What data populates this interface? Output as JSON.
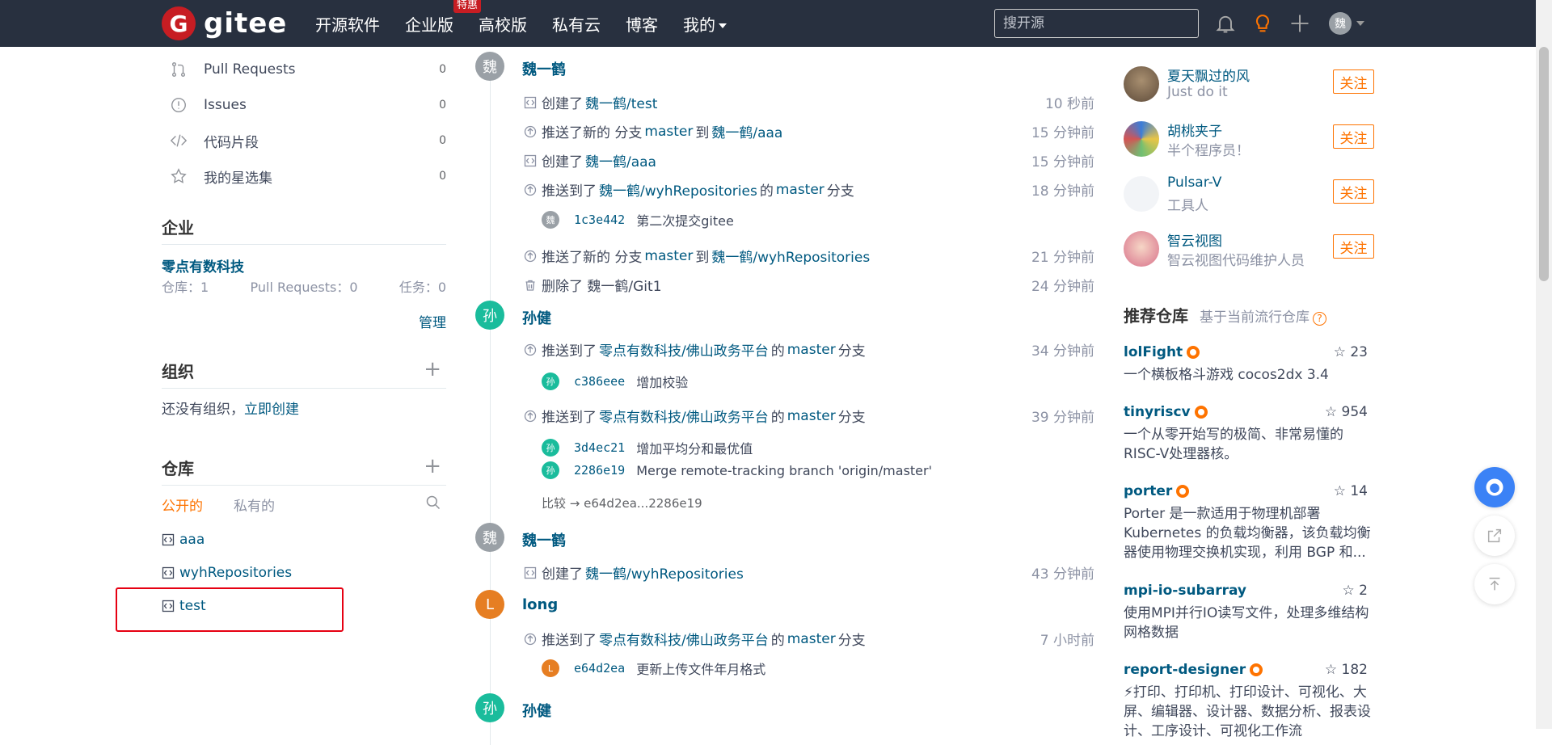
{
  "colors": {
    "topbar": "#28303f",
    "brand": "#c71d23",
    "link": "#005980",
    "accent": "#fe7300",
    "highlight": "#e60012"
  },
  "header": {
    "logo_letter": "G",
    "logo_text": "gitee",
    "nav": [
      {
        "label": "开源软件"
      },
      {
        "label": "企业版",
        "badge": "特惠"
      },
      {
        "label": "高校版"
      },
      {
        "label": "私有云"
      },
      {
        "label": "博客"
      },
      {
        "label": "我的"
      }
    ],
    "search_placeholder": "搜开源",
    "avatar_text": "魏"
  },
  "sidebar": {
    "menu": [
      {
        "label": "Pull Requests",
        "count": "0",
        "icon": "pull-request-icon"
      },
      {
        "label": "Issues",
        "count": "0",
        "icon": "issue-icon"
      },
      {
        "label": "代码片段",
        "count": "0",
        "icon": "code-snippet-icon"
      },
      {
        "label": "我的星选集",
        "count": "0",
        "icon": "star-icon"
      }
    ],
    "enterprise": {
      "title": "企业",
      "name": "零点有数科技",
      "repos": "仓库：1",
      "prs": "Pull Requests：0",
      "tasks": "任务：0",
      "manage": "管理"
    },
    "orgs": {
      "title": "组织",
      "empty_text": "还没有组织，",
      "create_link": "立即创建"
    },
    "repos": {
      "title": "仓库",
      "tab_public": "公开的",
      "tab_private": "私有的",
      "items": [
        "aaa",
        "wyhRepositories",
        "test"
      ]
    }
  },
  "feed": {
    "groups": [
      {
        "author": "魏一鹤",
        "avatar": "魏",
        "color": "#9aa0a6"
      },
      {
        "author": "孙健",
        "avatar": "孙",
        "color": "#1abc9c"
      },
      {
        "author": "魏一鹤",
        "avatar": "魏",
        "color": "#9aa0a6"
      },
      {
        "author": "long",
        "avatar": "L",
        "color": "#e67e22"
      },
      {
        "author": "孙健",
        "avatar": "孙",
        "color": "#1abc9c"
      }
    ],
    "events": [
      {
        "pre": "创建了",
        "link": "魏一鹤/test",
        "post": "",
        "time": "10 秒前",
        "icon": "repo-icon"
      },
      {
        "pre": "推送了新的 分支",
        "branch": "master",
        "mid": "到",
        "link": "魏一鹤/aaa",
        "post": "",
        "time": "15 分钟前",
        "icon": "push-icon"
      },
      {
        "pre": "创建了",
        "link": "魏一鹤/aaa",
        "post": "",
        "time": "15 分钟前",
        "icon": "repo-icon"
      },
      {
        "pre": "推送到了",
        "link": "魏一鹤/wyhRepositories",
        "post": "的",
        "branch2": "master",
        "post2": "分支",
        "time": "18 分钟前",
        "icon": "push-icon"
      },
      {
        "pre": "推送了新的 分支",
        "branch": "master",
        "mid": "到",
        "link": "魏一鹤/wyhRepositories",
        "post": "",
        "time": "21 分钟前",
        "icon": "push-icon"
      },
      {
        "pre": "删除了 魏一鹤/Git1",
        "time": "24 分钟前",
        "icon": "trash-icon"
      },
      {
        "pre": "推送到了",
        "link": "零点有数科技/佛山政务平台",
        "post": "的",
        "branch2": "master",
        "post2": "分支",
        "time": "34 分钟前",
        "icon": "push-icon"
      },
      {
        "pre": "推送到了",
        "link": "零点有数科技/佛山政务平台",
        "post": "的",
        "branch2": "master",
        "post2": "分支",
        "time": "39 分钟前",
        "icon": "push-icon"
      },
      {
        "pre": "创建了",
        "link": "魏一鹤/wyhRepositories",
        "post": "",
        "time": "43 分钟前",
        "icon": "repo-icon"
      },
      {
        "pre": "推送到了",
        "link": "零点有数科技/佛山政务平台",
        "post": "的",
        "branch2": "master",
        "post2": "分支",
        "time": "7 小时前",
        "icon": "push-icon"
      }
    ],
    "commits": [
      {
        "avatar": "魏",
        "color": "#9aa0a6",
        "sha": "1c3e442",
        "msg": "第二次提交gitee"
      },
      {
        "avatar": "孙",
        "color": "#1abc9c",
        "sha": "c386eee",
        "msg": "增加校验"
      },
      {
        "avatar": "孙",
        "color": "#1abc9c",
        "sha": "3d4ec21",
        "msg": "增加平均分和最优值"
      },
      {
        "avatar": "孙",
        "color": "#1abc9c",
        "sha": "2286e19",
        "msg": "Merge remote-tracking branch 'origin/master'"
      },
      {
        "avatar": "L",
        "color": "#e67e22",
        "sha": "e64d2ea",
        "msg": "更新上传文件年月格式"
      }
    ],
    "compare": "比较 → e64d2ea...2286e19"
  },
  "right": {
    "users": [
      {
        "name": "夏天飘过的风",
        "desc": "Just do it",
        "follow": "关注"
      },
      {
        "name": "胡桃夹子",
        "desc": "半个程序员！",
        "follow": "关注"
      },
      {
        "name": "Pulsar-V",
        "desc": "工具人",
        "follow": "关注"
      },
      {
        "name": "智云视图",
        "desc": "智云视图代码维护人员",
        "follow": "关注"
      }
    ],
    "rec_title": "推荐仓库",
    "rec_sub": "基于当前流行仓库",
    "repos": [
      {
        "name": "lolFight",
        "stars": "23",
        "desc": "一个横板格斗游戏 cocos2dx 3.4"
      },
      {
        "name": "tinyriscv",
        "stars": "954",
        "desc": "一个从零开始写的极简、非常易懂的RISC-V处理器核。"
      },
      {
        "name": "porter",
        "stars": "14",
        "desc": "Porter 是一款适用于物理机部署 Kubernetes 的负载均衡器，该负载均衡器使用物理交换机实现，利用 BGP 和..."
      },
      {
        "name": "mpi-io-subarray",
        "stars": "2",
        "desc": "使用MPI并行IO读写文件，处理多维结构网格数据"
      },
      {
        "name": "report-designer",
        "stars": "182",
        "desc": "⚡打印、打印机、打印设计、可视化、大屏、编辑器、设计器、数据分析、报表设计、工序设计、可视化工作流"
      }
    ]
  }
}
